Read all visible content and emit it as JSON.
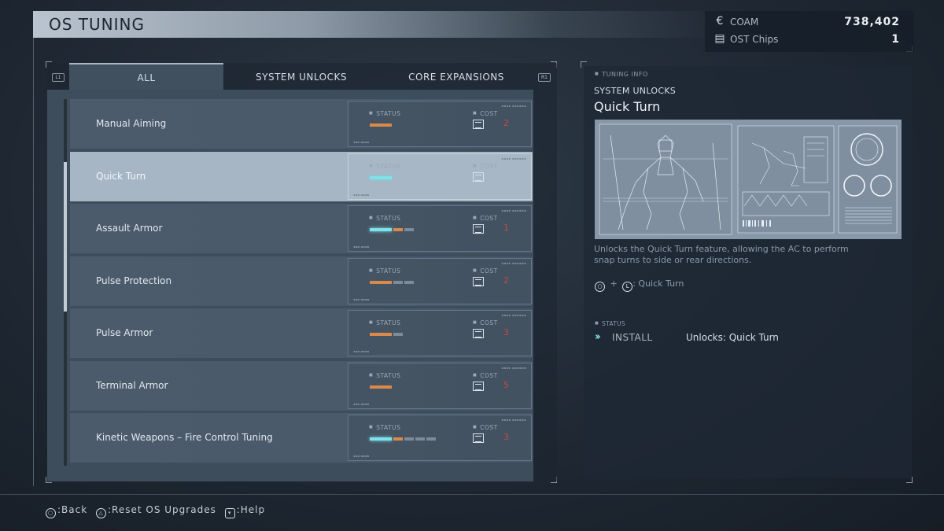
{
  "header": {
    "title": "OS TUNING"
  },
  "currency": [
    {
      "icon": "coam-icon",
      "glyph": "€",
      "label": "COAM",
      "value": "738,402"
    },
    {
      "icon": "ost-chip-icon",
      "glyph": "▤",
      "label": "OST Chips",
      "value": "1"
    }
  ],
  "tabs": {
    "left_shoulder": "L1",
    "right_shoulder": "R1",
    "items": [
      {
        "label": "ALL",
        "active": true
      },
      {
        "label": "SYSTEM UNLOCKS",
        "active": false
      },
      {
        "label": "CORE EXPANSIONS",
        "active": false
      }
    ]
  },
  "list": {
    "status_label": "STATUS",
    "cost_label": "COST",
    "items": [
      {
        "name": "Manual Aiming",
        "segments": [
          "orange"
        ],
        "cost": "2",
        "selected": false
      },
      {
        "name": "Quick Turn",
        "segments": [
          "cyan"
        ],
        "cost": "",
        "selected": true
      },
      {
        "name": "Assault Armor",
        "segments": [
          "cyan",
          "small-orange",
          "grey"
        ],
        "cost": "1",
        "selected": false
      },
      {
        "name": "Pulse Protection",
        "segments": [
          "orange",
          "grey",
          "grey"
        ],
        "cost": "2",
        "selected": false
      },
      {
        "name": "Pulse Armor",
        "segments": [
          "orange",
          "grey"
        ],
        "cost": "3",
        "selected": false
      },
      {
        "name": "Terminal Armor",
        "segments": [
          "orange"
        ],
        "cost": "5",
        "selected": false
      },
      {
        "name": "Kinetic Weapons – Fire Control Tuning",
        "segments": [
          "cyan",
          "small-orange",
          "grey",
          "grey",
          "grey"
        ],
        "cost": "3",
        "selected": false
      }
    ]
  },
  "info": {
    "tag": "TUNING INFO",
    "category": "SYSTEM UNLOCKS",
    "name": "Quick Turn",
    "description": "Unlocks the Quick Turn feature, allowing the AC to perform snap turns to side or rear directions.",
    "combo": {
      "button1": "○",
      "plus": "+",
      "button2": "L",
      "action": ": Quick Turn"
    },
    "status_label": "STATUS",
    "install_label": "INSTALL",
    "install_detail": "Unlocks: Quick Turn",
    "accent": "#7fe2ea"
  },
  "footer": [
    {
      "icon": "circle-button-icon",
      "glyph": "○",
      "label": ":Back"
    },
    {
      "icon": "triangle-button-icon",
      "glyph": "△",
      "label": ":Reset OS Upgrades"
    },
    {
      "icon": "touchpad-button-icon",
      "glyph": "▾",
      "label": ":Help"
    }
  ],
  "colors": {
    "cost_red": "#c44848",
    "orange": "#d98a4a",
    "cyan": "#7fe2ea"
  }
}
